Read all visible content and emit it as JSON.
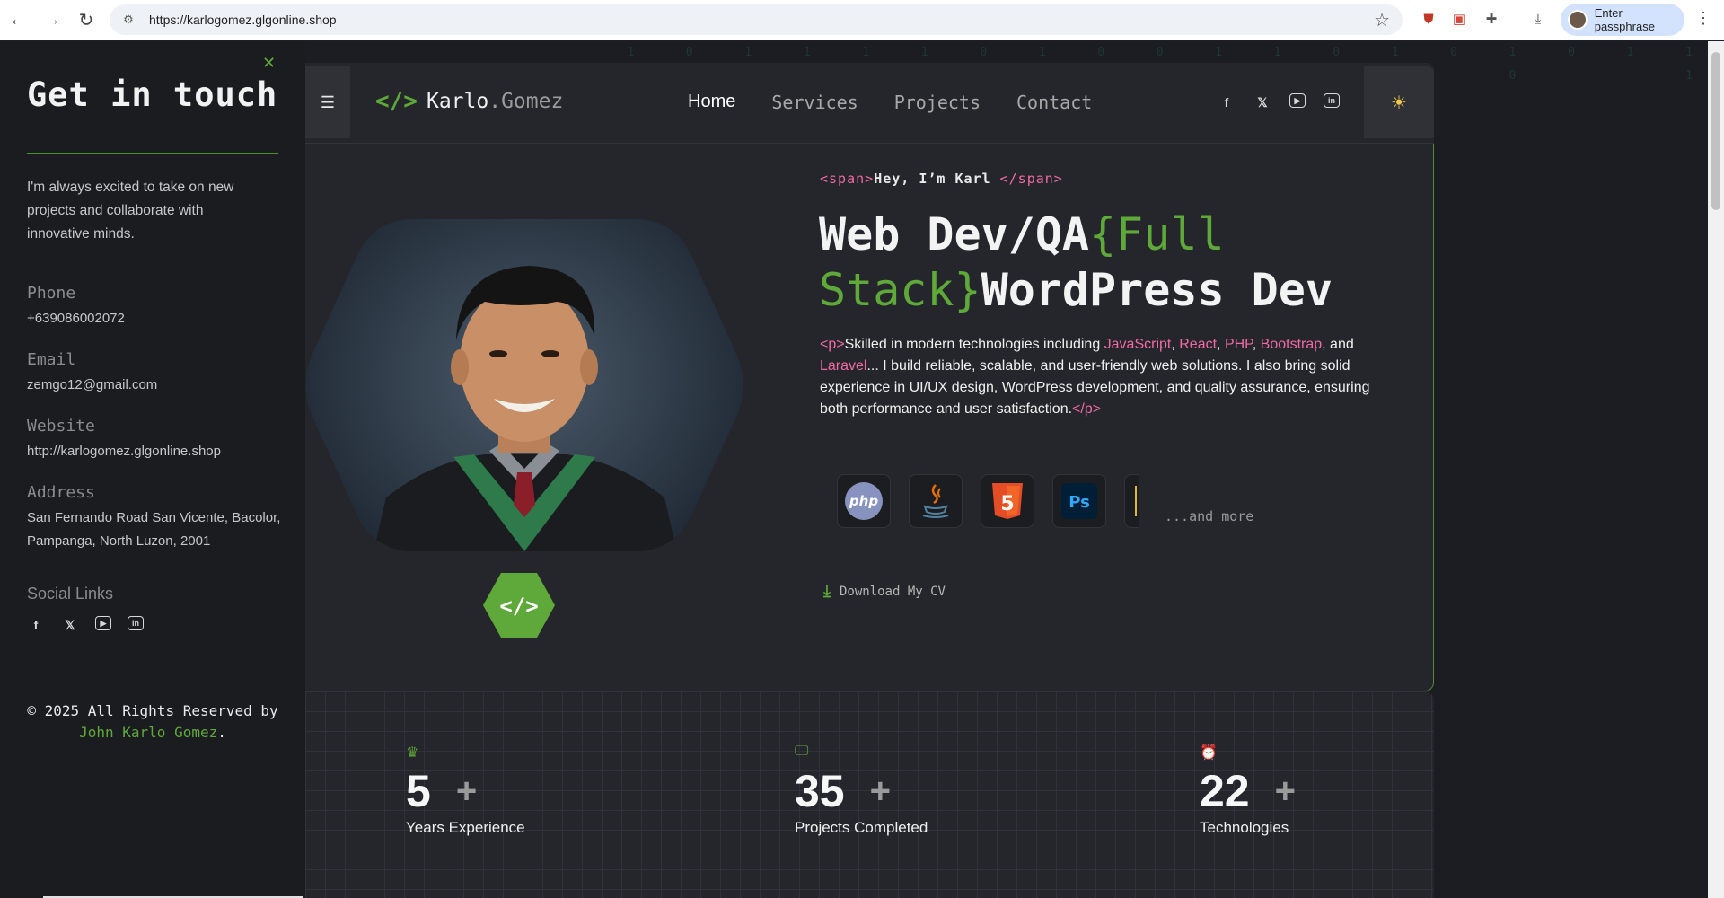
{
  "browser": {
    "url": "https://karlogomez.glgonline.shop",
    "profile_label": "Enter passphrase"
  },
  "sidebar": {
    "title": "Get in touch",
    "intro": "I'm always excited to take on new projects and collaborate with innovative minds.",
    "phone_label": "Phone",
    "phone": "+639086002072",
    "email_label": "Email",
    "email": "zemgo12@gmail.com",
    "website_label": "Website",
    "website": "http://karlogomez.glgonline.shop",
    "address_label": "Address",
    "address": "San Fernando Road San Vicente, Bacolor, Pampanga, North Luzon, 2001",
    "social_label": "Social Links",
    "copyright_prefix": "© 2025 All Rights Reserved by",
    "copyright_name": "John Karlo Gomez",
    "copyright_suffix": "."
  },
  "header": {
    "logo_first": "Karlo",
    "logo_second": ".Gomez",
    "nav": [
      "Home",
      "Services",
      "Projects",
      "Contact"
    ],
    "active": "Home"
  },
  "hero": {
    "span_open": "<span>",
    "greeting": "Hey, I’m Karl",
    "span_close": "</span>",
    "headline_1": "Web Dev/QA",
    "headline_2": "{Full Stack}",
    "headline_3": "WordPress Dev",
    "p_open": "<p>",
    "desc_1": "Skilled in modern technologies including ",
    "tech_js": "JavaScript",
    "sep1": ", ",
    "tech_react": "React",
    "sep2": ", ",
    "tech_php": "PHP",
    "sep3": ", ",
    "tech_bootstrap": "Bootstrap",
    "sep4": ", and ",
    "tech_laravel": "Laravel",
    "desc_2": "... I build reliable, scalable, and user-friendly web solutions. I also bring solid experience in UI/UX design, WordPress development, and quality assurance, ensuring both performance and user satisfaction.",
    "p_close": "</p>",
    "tech_icons": [
      "php-icon",
      "java-icon",
      "html5-icon",
      "photoshop-icon"
    ],
    "php_text": "php",
    "html_text": "5",
    "ps_text": "Ps",
    "more": "...and more",
    "cv_label": "Download My CV"
  },
  "stats": [
    {
      "icon": "crown-icon",
      "value": "5",
      "label": "Years Experience"
    },
    {
      "icon": "monitor-icon",
      "value": "35",
      "label": "Projects Completed"
    },
    {
      "icon": "alarm-clock-icon",
      "value": "22",
      "label": "Technologies"
    }
  ],
  "stat_plus": "+",
  "colors": {
    "accent_green": "#5fa83a",
    "tag_pink": "#f06aa3",
    "bg_dark": "#1c1d22",
    "card": "#25262c"
  }
}
